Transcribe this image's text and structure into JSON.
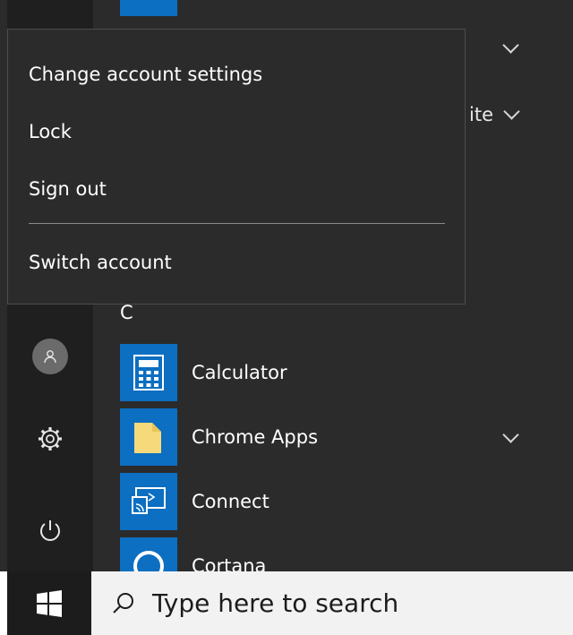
{
  "account_menu": {
    "items": [
      {
        "label": "Change account settings"
      },
      {
        "label": "Lock"
      },
      {
        "label": "Sign out"
      },
      {
        "label": "Switch account"
      }
    ]
  },
  "start_menu": {
    "group_suffix": "ite",
    "section_letter": "C",
    "apps": [
      {
        "label": "Calculator",
        "icon": "calculator-icon"
      },
      {
        "label": "Chrome Apps",
        "icon": "folder-icon",
        "expandable": true
      },
      {
        "label": "Connect",
        "icon": "connect-icon"
      },
      {
        "label": "Cortana",
        "icon": "cortana-icon"
      }
    ]
  },
  "rail": {
    "items": [
      "user-avatar-icon",
      "settings-gear-icon",
      "power-icon"
    ]
  },
  "taskbar": {
    "search_placeholder": "Type here to search"
  },
  "colors": {
    "accent": "#0c6fc1",
    "menu_bg": "#2b2b2b",
    "rail_bg": "#1f1f1f",
    "taskbar_search_bg": "#f2f2f2"
  }
}
